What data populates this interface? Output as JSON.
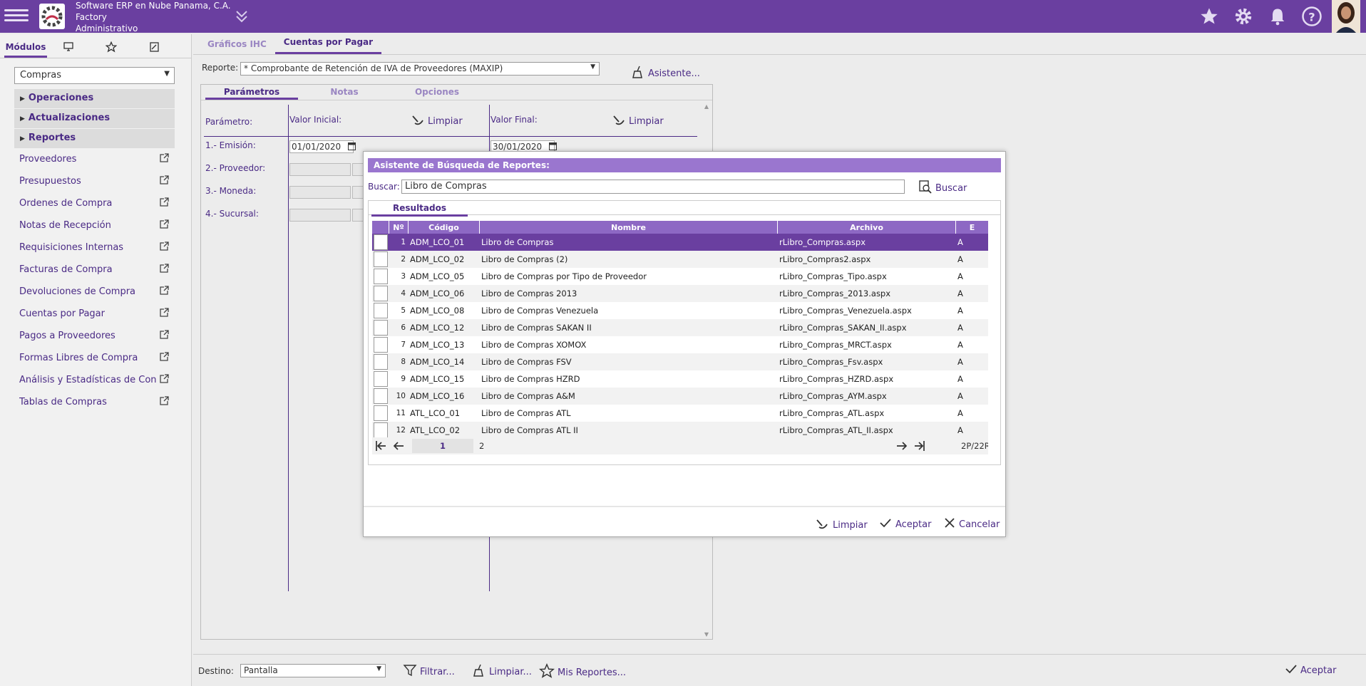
{
  "header": {
    "company": "Software ERP en Nube Panama, C.A.",
    "branch": "Factory",
    "role": "Administrativo"
  },
  "left_panel": {
    "tabs": [
      "Módulos"
    ],
    "module_select": "Compras",
    "accordion": [
      "Operaciones",
      "Actualizaciones",
      "Reportes"
    ],
    "items": [
      "Proveedores",
      "Presupuestos",
      "Órdenes de Compra",
      "Notas de Recepción",
      "Requisiciones Internas",
      "Facturas de Compra",
      "Devoluciones de Compra",
      "Cuentas por Pagar",
      "Pagos a Proveedores",
      "Formas Libres de Compra",
      "Análisis y Estadísticas de Con",
      "Tablas de Compras"
    ]
  },
  "main": {
    "tabs": [
      "Gráficos IHC",
      "Cuentas por Pagar"
    ],
    "report_label": "Reporte:",
    "report_value": "* Comprobante de Retención de IVA de Proveedores (MAXIP)",
    "asistente": "Asistente...",
    "param_tabs": [
      "Parámetros",
      "Notas",
      "Opciones"
    ],
    "param_header": "Parámetro:",
    "valor_inicial": "Valor Inicial:",
    "valor_final": "Valor Final:",
    "limpiar": "Limpiar",
    "params": [
      "1.- Emisión:",
      "2.- Proveedor:",
      "3.- Moneda:",
      "4.- Sucursal:"
    ],
    "emision_inicial": "01/01/2020",
    "emision_final": "30/01/2020"
  },
  "bottom": {
    "destino_label": "Destino:",
    "destino_value": "Pantalla",
    "filtrar": "Filtrar...",
    "limpiar": "Limpiar...",
    "mis_reportes": "Mis Reportes...",
    "aceptar": "Aceptar"
  },
  "dialog": {
    "title": "Asistente de Búsqueda de Reportes:",
    "buscar_label": "Buscar:",
    "buscar_value": "Libro de Compras",
    "buscar_button": "Buscar",
    "results_tab": "Resultados",
    "columns": [
      "Nº",
      "Código",
      "Nombre",
      "Archivo",
      "E"
    ],
    "rows": [
      {
        "n": "1",
        "codigo": "ADM_LCO_01",
        "nombre": "Libro de Compras",
        "archivo": "rLibro_Compras.aspx",
        "e": "A"
      },
      {
        "n": "2",
        "codigo": "ADM_LCO_02",
        "nombre": "Libro de Compras (2)",
        "archivo": "rLibro_Compras2.aspx",
        "e": "A"
      },
      {
        "n": "3",
        "codigo": "ADM_LCO_05",
        "nombre": "Libro de Compras por Tipo de Proveedor",
        "archivo": "rLibro_Compras_Tipo.aspx",
        "e": "A"
      },
      {
        "n": "4",
        "codigo": "ADM_LCO_06",
        "nombre": "Libro de Compras 2013",
        "archivo": "rLibro_Compras_2013.aspx",
        "e": "A"
      },
      {
        "n": "5",
        "codigo": "ADM_LCO_08",
        "nombre": "Libro de Compras Venezuela",
        "archivo": "rLibro_Compras_Venezuela.aspx",
        "e": "A"
      },
      {
        "n": "6",
        "codigo": "ADM_LCO_12",
        "nombre": "Libro de Compras SAKAN II",
        "archivo": "rLibro_Compras_SAKAN_II.aspx",
        "e": "A"
      },
      {
        "n": "7",
        "codigo": "ADM_LCO_13",
        "nombre": "Libro de Compras XOMOX",
        "archivo": "rLibro_Compras_MRCT.aspx",
        "e": "A"
      },
      {
        "n": "8",
        "codigo": "ADM_LCO_14",
        "nombre": "Libro de Compras FSV",
        "archivo": "rLibro_Compras_Fsv.aspx",
        "e": "A"
      },
      {
        "n": "9",
        "codigo": "ADM_LCO_15",
        "nombre": "Libro de Compras HZRD",
        "archivo": "rLibro_Compras_HZRD.aspx",
        "e": "A"
      },
      {
        "n": "10",
        "codigo": "ADM_LCO_16",
        "nombre": "Libro de Compras A&M",
        "archivo": "rLibro_Compras_AYM.aspx",
        "e": "A"
      },
      {
        "n": "11",
        "codigo": "ATL_LCO_01",
        "nombre": "Libro de Compras ATL",
        "archivo": "rLibro_Compras_ATL.aspx",
        "e": "A"
      },
      {
        "n": "12",
        "codigo": "ATL_LCO_02",
        "nombre": "Libro de Compras ATL II",
        "archivo": "rLibro_Compras_ATL_II.aspx",
        "e": "A"
      }
    ],
    "pager": {
      "current": "1",
      "next": "2",
      "summary": "2P/22R."
    },
    "footer": {
      "limpiar": "Limpiar",
      "aceptar": "Aceptar",
      "cancelar": "Cancelar"
    }
  },
  "colors": {
    "primary": "#6a3fa0",
    "dialog_title": "#9a76cf",
    "grid_header": "#8d68c4"
  },
  "icons": [
    "menu-icon",
    "company-logo",
    "chevrons-down-icon",
    "star-icon",
    "gear-icon",
    "bell-icon",
    "help-icon",
    "avatar",
    "monitor-icon",
    "star-outline-icon",
    "report-icon",
    "external-link-icon",
    "broom-icon",
    "search-icon",
    "filter-icon",
    "check-icon",
    "close-icon",
    "calendar-icon",
    "first-page-icon",
    "prev-page-icon",
    "next-page-icon",
    "last-page-icon"
  ]
}
